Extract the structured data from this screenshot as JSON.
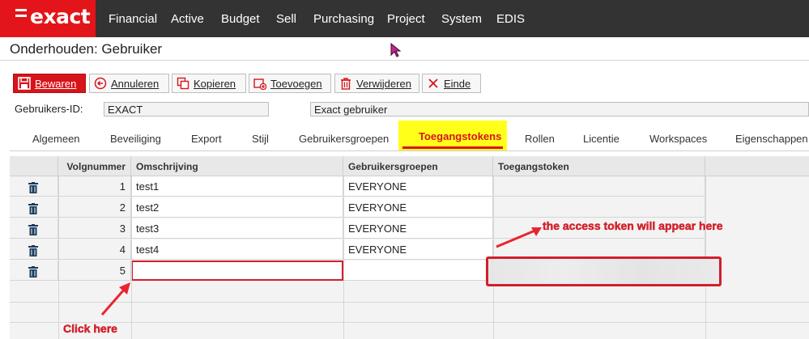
{
  "app": {
    "logo_text": "exact"
  },
  "nav": {
    "items": [
      "Financial",
      "Active",
      "Budget",
      "Sell",
      "Purchasing",
      "Project",
      "System",
      "EDIS"
    ]
  },
  "page": {
    "title": "Onderhouden: Gebruiker"
  },
  "toolbar": {
    "save": "Bewaren",
    "cancel": "Annuleren",
    "copy": "Kopieren",
    "add": "Toevoegen",
    "delete": "Verwijderen",
    "end": "Einde"
  },
  "form": {
    "user_id_label": "Gebruikers-ID:",
    "user_id_value": "EXACT",
    "description_value": "Exact gebruiker"
  },
  "tabs": {
    "items": [
      "Algemeen",
      "Beveiliging",
      "Export",
      "Stijl",
      "Gebruikersgroepen",
      "Toegangstokens",
      "Rollen",
      "Licentie",
      "Workspaces",
      "Eigenschappen"
    ],
    "active": "Toegangstokens"
  },
  "grid": {
    "columns": [
      "Volgnummer",
      "Omschrijving",
      "Gebruikersgroepen",
      "Toegangstoken"
    ],
    "rows": [
      {
        "nr": "1",
        "desc": "test1",
        "group": "EVERYONE",
        "token": ""
      },
      {
        "nr": "2",
        "desc": "test2",
        "group": "EVERYONE",
        "token": ""
      },
      {
        "nr": "3",
        "desc": "test3",
        "group": "EVERYONE",
        "token": ""
      },
      {
        "nr": "4",
        "desc": "test4",
        "group": "EVERYONE",
        "token": ""
      },
      {
        "nr": "5",
        "desc": "",
        "group": "",
        "token": ""
      }
    ]
  },
  "annotations": {
    "token_note": "the access token will appear here",
    "click_note": "Click here",
    "color": "#e8242f"
  },
  "colors": {
    "brand": "#e3151a",
    "nav_bg": "#333333",
    "tab_highlight": "#ffff1a"
  }
}
